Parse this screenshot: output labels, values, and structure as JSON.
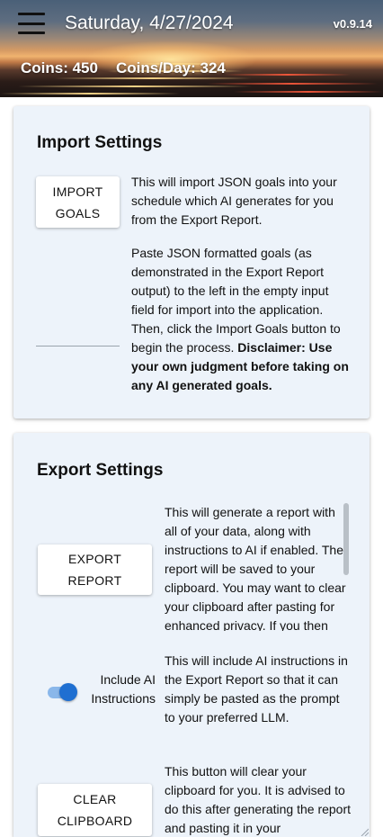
{
  "header": {
    "date": "Saturday, 4/27/2024",
    "version": "v0.9.14",
    "coins": "Coins: 450",
    "coins_per_day": "Coins/Day: 324"
  },
  "import_settings": {
    "title": "Import Settings",
    "button_label_line1": "IMPORT",
    "button_label_line2": "GOALS",
    "description": "This will import JSON goals into your schedule which AI generates for you from the Export Report.",
    "instructions": "Paste JSON formatted goals (as demonstrated in the Export Report output) to the left in the empty input field for import into the application. Then, click the Import Goals button to begin the process. ",
    "disclaimer": "Disclaimer: Use your own judgment before taking on any AI generated goals.",
    "json_input_value": ""
  },
  "export_settings": {
    "title": "Export Settings",
    "export_button_line1": "EXPORT",
    "export_button_line2": "REPORT",
    "export_description": "This will generate a report with all of your data, along with instructions to AI if enabled. The report will be saved to your clipboard. You may want to clear your clipboard after pasting for enhanced privacy. If you then",
    "toggle_label": "Include AI Instructions",
    "toggle_on": true,
    "toggle_description": "This will include AI instructions in the Export Report so that it can simply be pasted as the prompt to your preferred LLM.",
    "clear_button_line1": "CLEAR",
    "clear_button_line2": "CLIPBOARD",
    "clear_description": "This button will clear your clipboard for you. It is advised to do this after generating the report and pasting it in your"
  },
  "colors": {
    "card_background": "#edf3fa",
    "toggle_accent": "#1f6fd1"
  }
}
